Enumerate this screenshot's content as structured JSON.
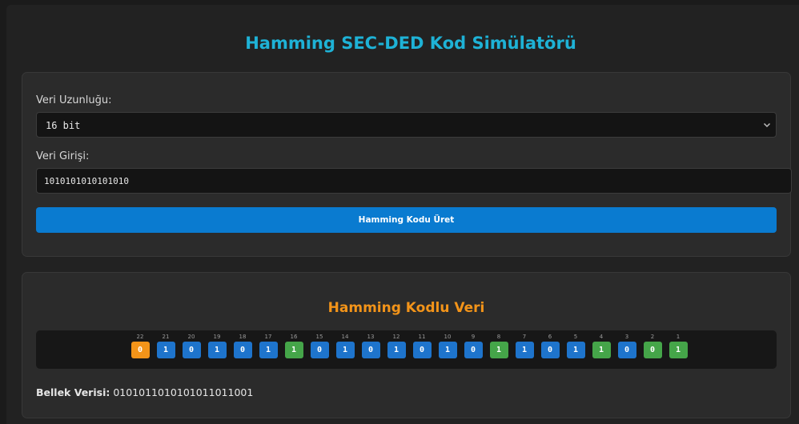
{
  "title": "Hamming SEC-DED Kod Simülatörü",
  "form": {
    "length_label": "Veri Uzunluğu:",
    "length_value": "16 bit",
    "data_label": "Veri Girişi:",
    "data_value": "1010101010101010",
    "generate_button": "Hamming Kodu Üret"
  },
  "result": {
    "title": "Hamming Kodlu Veri",
    "bits": [
      {
        "pos": "22",
        "value": "0",
        "kind": "overall"
      },
      {
        "pos": "21",
        "value": "1",
        "kind": "data"
      },
      {
        "pos": "20",
        "value": "0",
        "kind": "data"
      },
      {
        "pos": "19",
        "value": "1",
        "kind": "data"
      },
      {
        "pos": "18",
        "value": "0",
        "kind": "data"
      },
      {
        "pos": "17",
        "value": "1",
        "kind": "data"
      },
      {
        "pos": "16",
        "value": "1",
        "kind": "parity"
      },
      {
        "pos": "15",
        "value": "0",
        "kind": "data"
      },
      {
        "pos": "14",
        "value": "1",
        "kind": "data"
      },
      {
        "pos": "13",
        "value": "0",
        "kind": "data"
      },
      {
        "pos": "12",
        "value": "1",
        "kind": "data"
      },
      {
        "pos": "11",
        "value": "0",
        "kind": "data"
      },
      {
        "pos": "10",
        "value": "1",
        "kind": "data"
      },
      {
        "pos": "9",
        "value": "0",
        "kind": "data"
      },
      {
        "pos": "8",
        "value": "1",
        "kind": "parity"
      },
      {
        "pos": "7",
        "value": "1",
        "kind": "data"
      },
      {
        "pos": "6",
        "value": "0",
        "kind": "data"
      },
      {
        "pos": "5",
        "value": "1",
        "kind": "data"
      },
      {
        "pos": "4",
        "value": "1",
        "kind": "parity"
      },
      {
        "pos": "3",
        "value": "0",
        "kind": "data"
      },
      {
        "pos": "2",
        "value": "0",
        "kind": "parity"
      },
      {
        "pos": "1",
        "value": "1",
        "kind": "parity"
      }
    ],
    "memory_label": "Bellek Verisi:",
    "memory_value": "0101011010101011011001"
  },
  "colors": {
    "title": "#1eb2d6",
    "section_title": "#f39419",
    "button": "#0a7bd0",
    "bit_data": "#1e74cc",
    "bit_parity": "#45a549",
    "bit_overall": "#f39419"
  }
}
